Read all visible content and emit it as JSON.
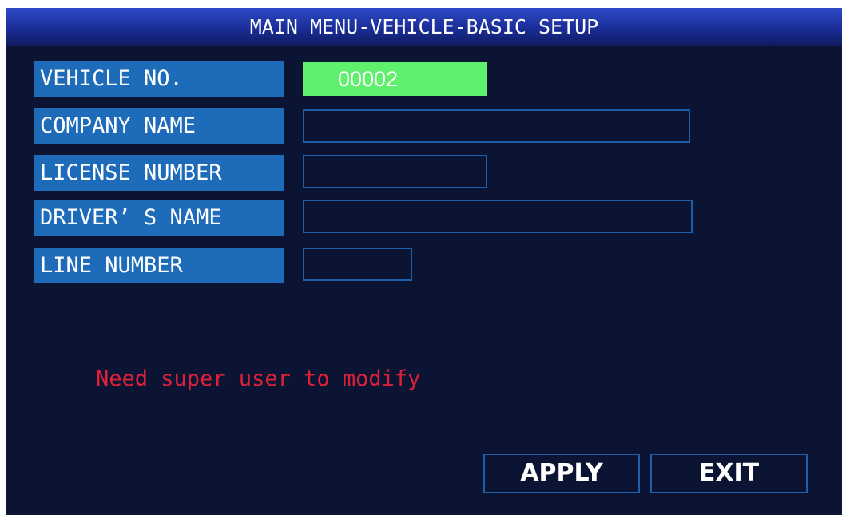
{
  "header": {
    "title": "MAIN MENU-VEHICLE-BASIC SETUP"
  },
  "form": {
    "vehicle_no": {
      "label": "VEHICLE NO.",
      "value": "00002"
    },
    "company_name": {
      "label": "COMPANY NAME",
      "value": ""
    },
    "license_number": {
      "label": "LICENSE NUMBER",
      "value": ""
    },
    "drivers_name": {
      "label": "DRIVER’ S NAME",
      "value": ""
    },
    "line_number": {
      "label": "LINE NUMBER",
      "value": ""
    }
  },
  "message": {
    "warning": "Need super user to modify"
  },
  "buttons": {
    "apply": "APPLY",
    "exit": "EXIT"
  },
  "colors": {
    "background": "#0b1533",
    "label_bg": "#1d6bb9",
    "field_border": "#1d5fa8",
    "active_field": "#5ff06e",
    "warning": "#e0203a"
  }
}
